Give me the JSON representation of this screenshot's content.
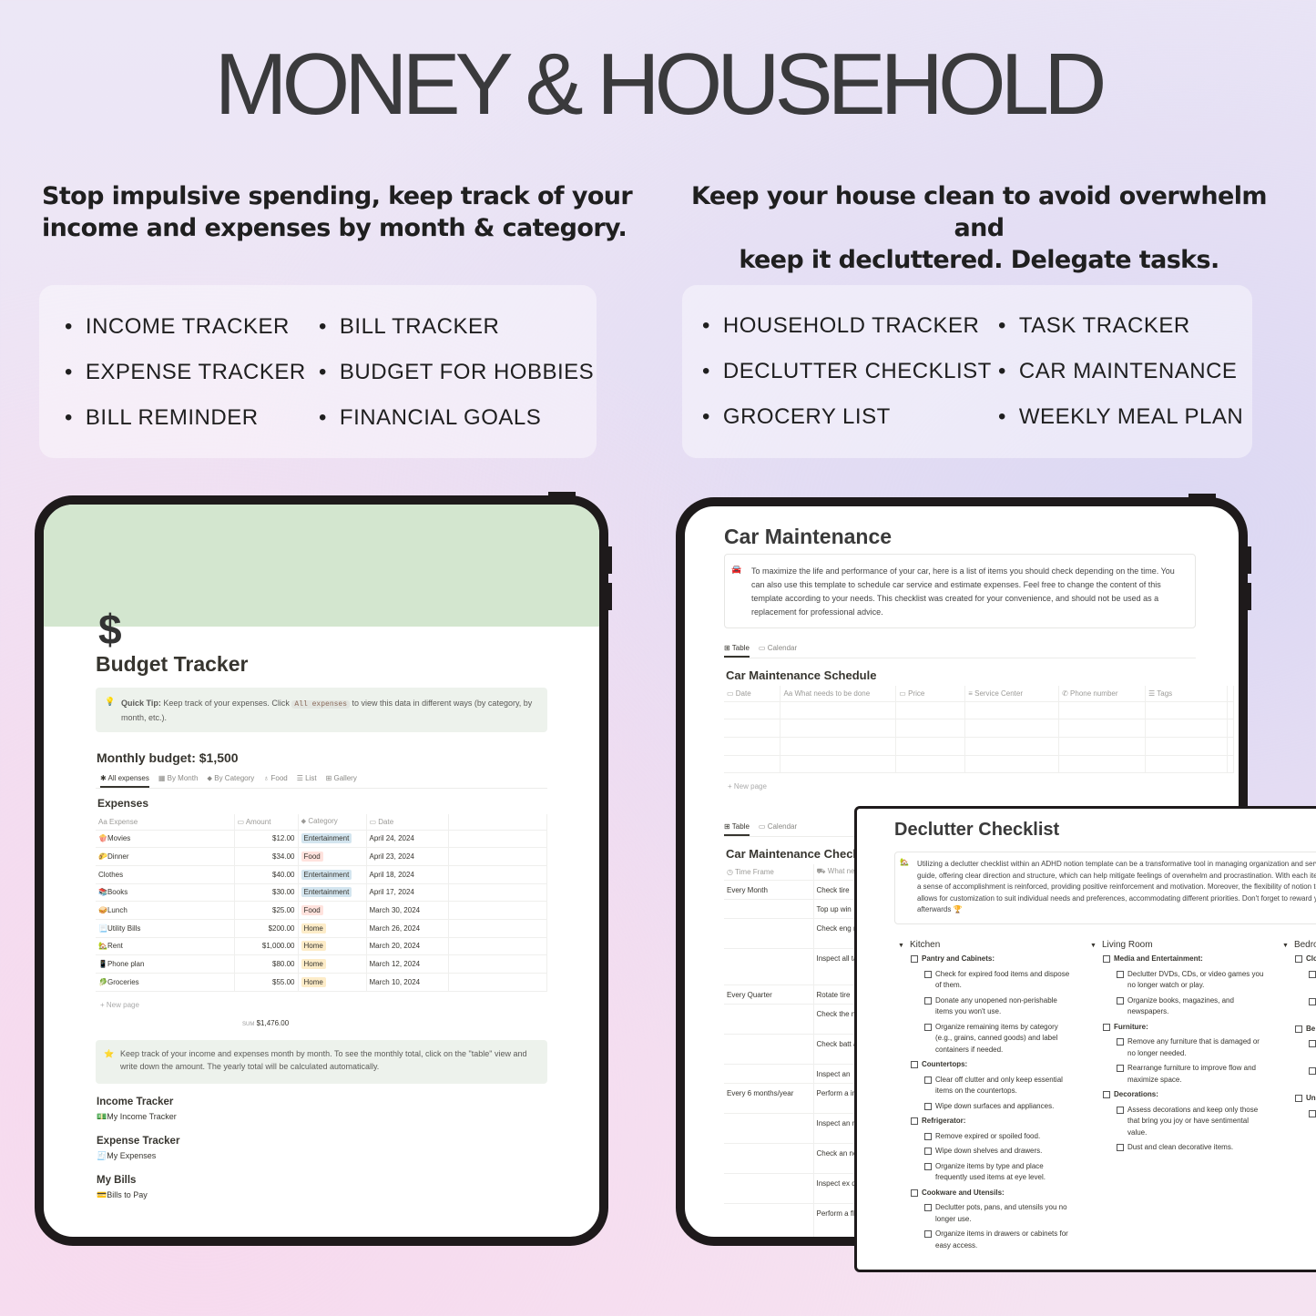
{
  "title": "MONEY & HOUSEHOLD",
  "left": {
    "subtitle_l1": "Stop impulsive spending, keep track of your",
    "subtitle_l2": "income and expenses by month & category.",
    "features": [
      "INCOME TRACKER",
      "EXPENSE TRACKER",
      "BILL REMINDER",
      "BILL TRACKER",
      "BUDGET FOR HOBBIES",
      "FINANCIAL GOALS"
    ]
  },
  "right": {
    "subtitle_l1": "Keep your house clean to avoid overwhelm and",
    "subtitle_l2": "keep it decluttered. Delegate tasks.",
    "features": [
      "HOUSEHOLD TRACKER",
      "DECLUTTER CHECKLIST",
      "GROCERY LIST",
      "TASK TRACKER",
      "CAR MAINTENANCE",
      "WEEKLY MEAL PLAN"
    ]
  },
  "budget": {
    "icon": "$",
    "title": "Budget Tracker",
    "tip_label": "Quick Tip:",
    "tip_a": " Keep track of your expenses. Click ",
    "tip_code": "All expenses",
    "tip_b": " to view this data in different ways (by category, by month, etc.).",
    "monthly": "Monthly budget: $1,500",
    "tabs": [
      "✱ All expenses",
      "▦ By Month",
      "⬥ By Category",
      "♁ Food",
      "☰ List",
      "⊞ Gallery"
    ],
    "table_title": "Expenses",
    "columns": [
      "Aa Expense",
      "▭ Amount",
      "⬥ Category",
      "▭ Date"
    ],
    "rows": [
      {
        "icon": "🍿",
        "name": "Movies",
        "amount": "$12.00",
        "cat": "Entertainment",
        "cls": "ent",
        "date": "April 24, 2024"
      },
      {
        "icon": "🌮",
        "name": "Dinner",
        "amount": "$34.00",
        "cat": "Food",
        "cls": "food",
        "date": "April 23, 2024"
      },
      {
        "icon": "",
        "name": "Clothes",
        "amount": "$40.00",
        "cat": "Entertainment",
        "cls": "ent",
        "date": "April 18, 2024"
      },
      {
        "icon": "📚",
        "name": "Books",
        "amount": "$30.00",
        "cat": "Entertainment",
        "cls": "ent",
        "date": "April 17, 2024"
      },
      {
        "icon": "🥪",
        "name": "Lunch",
        "amount": "$25.00",
        "cat": "Food",
        "cls": "food",
        "date": "March 30, 2024"
      },
      {
        "icon": "📃",
        "name": "Utility Bills",
        "amount": "$200.00",
        "cat": "Home",
        "cls": "home",
        "date": "March 26, 2024"
      },
      {
        "icon": "🏡",
        "name": "Rent",
        "amount": "$1,000.00",
        "cat": "Home",
        "cls": "home",
        "date": "March 20, 2024"
      },
      {
        "icon": "📱",
        "name": "Phone plan",
        "amount": "$80.00",
        "cat": "Home",
        "cls": "home",
        "date": "March 12, 2024"
      },
      {
        "icon": "🥬",
        "name": "Groceries",
        "amount": "$55.00",
        "cat": "Home",
        "cls": "home",
        "date": "March 10, 2024"
      }
    ],
    "new_page": "+ New page",
    "sum_label": "SUM",
    "sum": "$1,476.00",
    "tip2": "Keep track of your income and expenses month by month. To see the monthly total, click on the \"table\" view and write down the amount. The yearly total will be calculated automatically.",
    "sections": [
      {
        "heading": "Income Tracker",
        "icon": "💵",
        "link": "My Income Tracker"
      },
      {
        "heading": "Expense Tracker",
        "icon": "🧾",
        "link": "My Expenses"
      },
      {
        "heading": "My Bills",
        "icon": "💳",
        "link": "Bills to Pay"
      }
    ]
  },
  "car": {
    "title": "Car Maintenance",
    "callout": "To maximize the life and performance of your car, here is a list of items you should check depending on the time. You can also use this template to schedule car service and estimate expenses. Feel free to change the content of this template according to your needs. This checklist was created for your convenience, and should not be used as a replacement for professional advice.",
    "tabs": [
      "⊞ Table",
      "▭ Calendar"
    ],
    "schedule_title": "Car Maintenance Schedule",
    "schedule_cols": [
      "▭ Date",
      "Aa What needs to be done",
      "▭ Price",
      "≡ Service Center",
      "✆ Phone number",
      "☰ Tags"
    ],
    "new_page": "+ New page",
    "check_title": "Car Maintenance Checklist",
    "check_cols": [
      "◷ Time Frame",
      "⛟ What needs to be done"
    ],
    "check_rows": [
      [
        "Every Month",
        "Check tire"
      ],
      [
        "",
        "Top up win"
      ],
      [
        "",
        "Check eng needed."
      ],
      [
        "",
        "Inspect all taillights, t operation."
      ],
      [
        "Every Quarter",
        "Rotate tire"
      ],
      [
        "",
        "Check the needed."
      ],
      [
        "",
        "Check batt and clean"
      ],
      [
        "",
        "Inspect an"
      ],
      [
        "Every 6 months/year",
        "Perform a inspection"
      ],
      [
        "",
        "Inspect an needed."
      ],
      [
        "",
        "Check an necessary."
      ],
      [
        "",
        "Inspect ex damage."
      ],
      [
        "",
        "Perform a fluid levels needed (tr"
      ]
    ]
  },
  "declutter": {
    "title": "Declutter Checklist",
    "callout": "Utilizing a declutter checklist within an ADHD notion template can be a transformative tool in managing organization and serves as a visual guide, offering clear direction and structure, which can help mitigate feelings of overwhelm and procrastination. With each item checked off, a sense of accomplishment is reinforced, providing positive reinforcement and motivation. Moreover, the flexibility of notion templates allows for customization to suit individual needs and preferences, accommodating different priorities. Don't forget to reward yourself afterwards 🏆",
    "columns": [
      {
        "room": "Kitchen",
        "groups": [
          {
            "name": "Pantry and Cabinets:",
            "items": [
              "Check for expired food items and dispose of them.",
              "Donate any unopened non-perishable items you won't use.",
              "Organize remaining items by category (e.g., grains, canned goods) and label containers if needed."
            ]
          },
          {
            "name": "Countertops:",
            "items": [
              "Clear off clutter and only keep essential items on the countertops.",
              "Wipe down surfaces and appliances."
            ]
          },
          {
            "name": "Refrigerator:",
            "items": [
              "Remove expired or spoiled food.",
              "Wipe down shelves and drawers.",
              "Organize items by type and place frequently used items at eye level."
            ]
          },
          {
            "name": "Cookware and Utensils:",
            "items": [
              "Declutter pots, pans, and utensils you no longer use.",
              "Organize items in drawers or cabinets for easy access."
            ]
          }
        ]
      },
      {
        "room": "Living Room",
        "groups": [
          {
            "name": "Media and Entertainment:",
            "items": [
              "Declutter DVDs, CDs, or video games you no longer watch or play.",
              "Organize books, magazines, and newspapers."
            ]
          },
          {
            "name": "Furniture:",
            "items": [
              "Remove any furniture that is damaged or no longer needed.",
              "Rearrange furniture to improve flow and maximize space."
            ]
          },
          {
            "name": "Decorations:",
            "items": [
              "Assess decorations and keep only those that bring you joy or have sentimental value.",
              "Dust and clean decorative items."
            ]
          }
        ]
      },
      {
        "room": "Bedro",
        "groups": [
          {
            "name": "Clo",
            "items": [
              "",
              ""
            ]
          },
          {
            "name": "Be",
            "items": [
              "",
              ""
            ]
          },
          {
            "name": "Un",
            "items": [
              ""
            ]
          }
        ]
      }
    ]
  }
}
